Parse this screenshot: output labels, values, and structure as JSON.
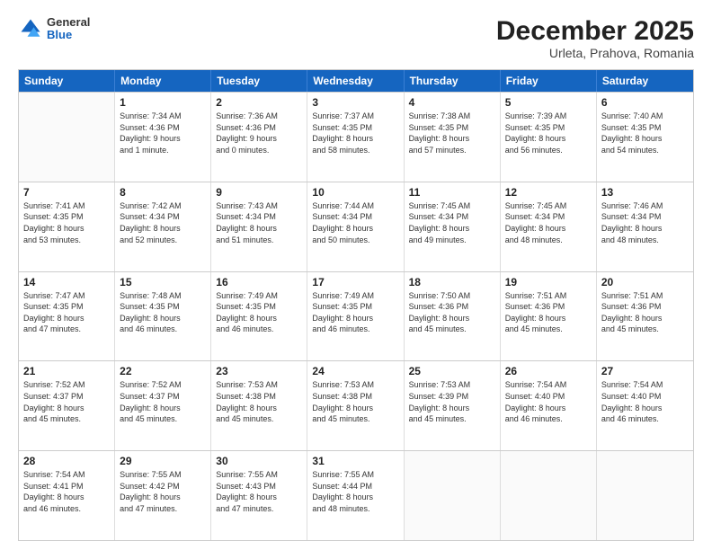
{
  "logo": {
    "general": "General",
    "blue": "Blue"
  },
  "title": "December 2025",
  "subtitle": "Urleta, Prahova, Romania",
  "days": [
    "Sunday",
    "Monday",
    "Tuesday",
    "Wednesday",
    "Thursday",
    "Friday",
    "Saturday"
  ],
  "weeks": [
    [
      {
        "day": "",
        "content": ""
      },
      {
        "day": "1",
        "content": "Sunrise: 7:34 AM\nSunset: 4:36 PM\nDaylight: 9 hours\nand 1 minute."
      },
      {
        "day": "2",
        "content": "Sunrise: 7:36 AM\nSunset: 4:36 PM\nDaylight: 9 hours\nand 0 minutes."
      },
      {
        "day": "3",
        "content": "Sunrise: 7:37 AM\nSunset: 4:35 PM\nDaylight: 8 hours\nand 58 minutes."
      },
      {
        "day": "4",
        "content": "Sunrise: 7:38 AM\nSunset: 4:35 PM\nDaylight: 8 hours\nand 57 minutes."
      },
      {
        "day": "5",
        "content": "Sunrise: 7:39 AM\nSunset: 4:35 PM\nDaylight: 8 hours\nand 56 minutes."
      },
      {
        "day": "6",
        "content": "Sunrise: 7:40 AM\nSunset: 4:35 PM\nDaylight: 8 hours\nand 54 minutes."
      }
    ],
    [
      {
        "day": "7",
        "content": "Sunrise: 7:41 AM\nSunset: 4:35 PM\nDaylight: 8 hours\nand 53 minutes."
      },
      {
        "day": "8",
        "content": "Sunrise: 7:42 AM\nSunset: 4:34 PM\nDaylight: 8 hours\nand 52 minutes."
      },
      {
        "day": "9",
        "content": "Sunrise: 7:43 AM\nSunset: 4:34 PM\nDaylight: 8 hours\nand 51 minutes."
      },
      {
        "day": "10",
        "content": "Sunrise: 7:44 AM\nSunset: 4:34 PM\nDaylight: 8 hours\nand 50 minutes."
      },
      {
        "day": "11",
        "content": "Sunrise: 7:45 AM\nSunset: 4:34 PM\nDaylight: 8 hours\nand 49 minutes."
      },
      {
        "day": "12",
        "content": "Sunrise: 7:45 AM\nSunset: 4:34 PM\nDaylight: 8 hours\nand 48 minutes."
      },
      {
        "day": "13",
        "content": "Sunrise: 7:46 AM\nSunset: 4:34 PM\nDaylight: 8 hours\nand 48 minutes."
      }
    ],
    [
      {
        "day": "14",
        "content": "Sunrise: 7:47 AM\nSunset: 4:35 PM\nDaylight: 8 hours\nand 47 minutes."
      },
      {
        "day": "15",
        "content": "Sunrise: 7:48 AM\nSunset: 4:35 PM\nDaylight: 8 hours\nand 46 minutes."
      },
      {
        "day": "16",
        "content": "Sunrise: 7:49 AM\nSunset: 4:35 PM\nDaylight: 8 hours\nand 46 minutes."
      },
      {
        "day": "17",
        "content": "Sunrise: 7:49 AM\nSunset: 4:35 PM\nDaylight: 8 hours\nand 46 minutes."
      },
      {
        "day": "18",
        "content": "Sunrise: 7:50 AM\nSunset: 4:36 PM\nDaylight: 8 hours\nand 45 minutes."
      },
      {
        "day": "19",
        "content": "Sunrise: 7:51 AM\nSunset: 4:36 PM\nDaylight: 8 hours\nand 45 minutes."
      },
      {
        "day": "20",
        "content": "Sunrise: 7:51 AM\nSunset: 4:36 PM\nDaylight: 8 hours\nand 45 minutes."
      }
    ],
    [
      {
        "day": "21",
        "content": "Sunrise: 7:52 AM\nSunset: 4:37 PM\nDaylight: 8 hours\nand 45 minutes."
      },
      {
        "day": "22",
        "content": "Sunrise: 7:52 AM\nSunset: 4:37 PM\nDaylight: 8 hours\nand 45 minutes."
      },
      {
        "day": "23",
        "content": "Sunrise: 7:53 AM\nSunset: 4:38 PM\nDaylight: 8 hours\nand 45 minutes."
      },
      {
        "day": "24",
        "content": "Sunrise: 7:53 AM\nSunset: 4:38 PM\nDaylight: 8 hours\nand 45 minutes."
      },
      {
        "day": "25",
        "content": "Sunrise: 7:53 AM\nSunset: 4:39 PM\nDaylight: 8 hours\nand 45 minutes."
      },
      {
        "day": "26",
        "content": "Sunrise: 7:54 AM\nSunset: 4:40 PM\nDaylight: 8 hours\nand 46 minutes."
      },
      {
        "day": "27",
        "content": "Sunrise: 7:54 AM\nSunset: 4:40 PM\nDaylight: 8 hours\nand 46 minutes."
      }
    ],
    [
      {
        "day": "28",
        "content": "Sunrise: 7:54 AM\nSunset: 4:41 PM\nDaylight: 8 hours\nand 46 minutes."
      },
      {
        "day": "29",
        "content": "Sunrise: 7:55 AM\nSunset: 4:42 PM\nDaylight: 8 hours\nand 47 minutes."
      },
      {
        "day": "30",
        "content": "Sunrise: 7:55 AM\nSunset: 4:43 PM\nDaylight: 8 hours\nand 47 minutes."
      },
      {
        "day": "31",
        "content": "Sunrise: 7:55 AM\nSunset: 4:44 PM\nDaylight: 8 hours\nand 48 minutes."
      },
      {
        "day": "",
        "content": ""
      },
      {
        "day": "",
        "content": ""
      },
      {
        "day": "",
        "content": ""
      }
    ]
  ]
}
